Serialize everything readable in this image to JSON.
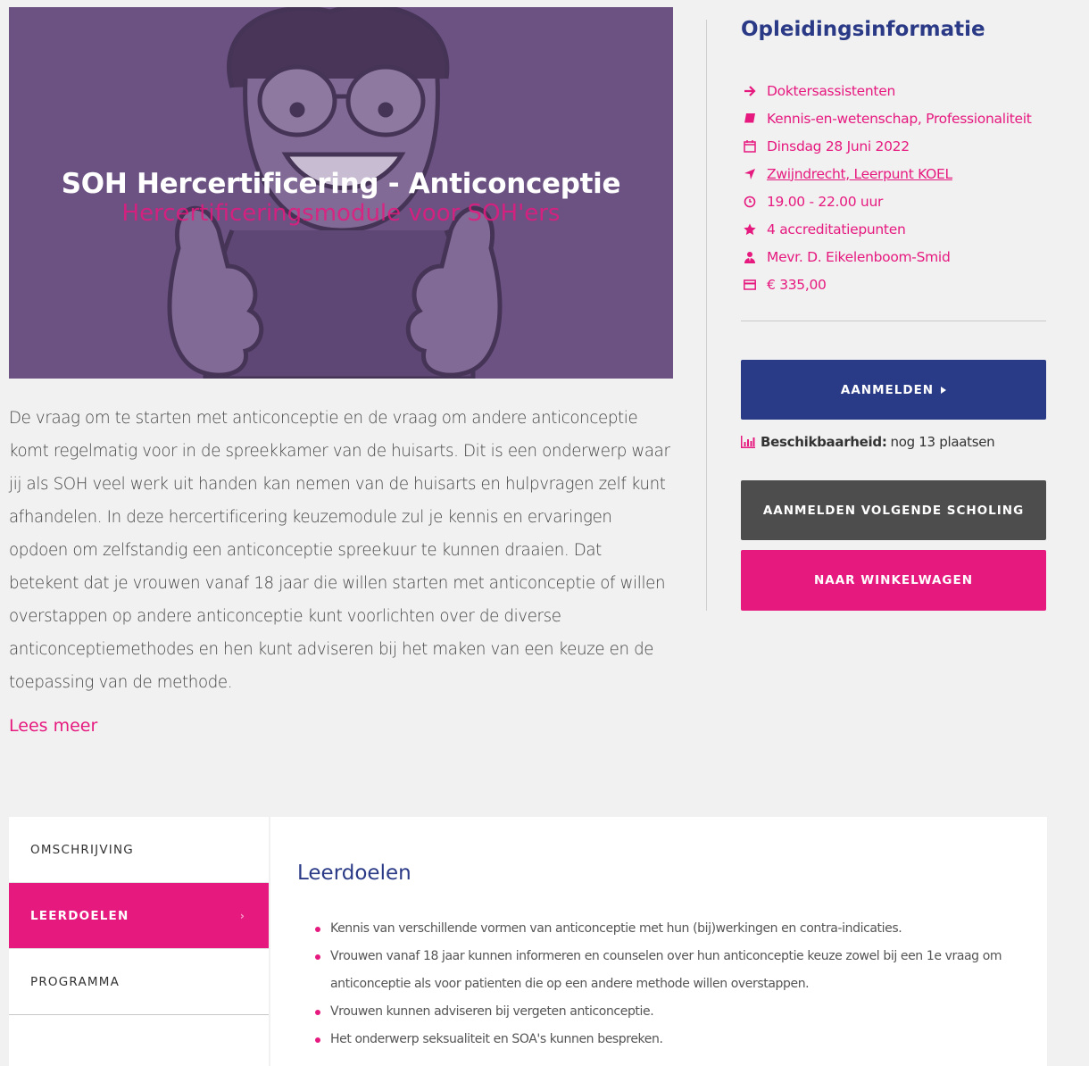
{
  "hero": {
    "title": "SOH Hercertificering - Anticonceptie",
    "subtitle": "Hercertificeringsmodule voor SOH'ers"
  },
  "description": "De vraag om te starten met anticonceptie en de vraag om andere anticonceptie komt regelmatig voor in de spreekkamer van de huisarts. Dit is een onderwerp waar jij als SOH veel werk uit handen kan nemen van de huisarts en hulpvragen zelf kunt afhandelen. In deze hercertificering keuzemodule zul je kennis en ervaringen opdoen om zelfstandig een anticonceptie spreekuur te kunnen draaien. Dat betekent dat je vrouwen vanaf 18 jaar die willen starten met anticonceptie of willen overstappen op andere anticonceptie kunt voorlichten over de diverse anticonceptiemethodes en hen kunt adviseren bij het maken van een keuze en de toepassing van de methode.",
  "lees_meer": "Lees meer",
  "sidebar": {
    "title": "Opleidingsinformatie",
    "items": [
      {
        "icon": "arrow-right-icon",
        "text": "Doktersassistenten"
      },
      {
        "icon": "book-icon",
        "text": "Kennis-en-wetenschap, Professionaliteit"
      },
      {
        "icon": "calendar-icon",
        "text": "Dinsdag 28 Juni 2022"
      },
      {
        "icon": "location-arrow-icon",
        "text": "Zwijndrecht, Leerpunt KOEL"
      },
      {
        "icon": "clock-icon",
        "text": "19.00 - 22.00 uur"
      },
      {
        "icon": "star-icon",
        "text": "4 accreditatiepunten"
      },
      {
        "icon": "user-tie-icon",
        "text": "Mevr. D. Eikelenboom-Smid"
      },
      {
        "icon": "credit-card-icon",
        "text": "€ 335,00"
      }
    ],
    "aanmelden": "AANMELDEN",
    "availability_label": "Beschikbaarheid:",
    "availability_value": "nog 13 plaatsen",
    "aanmelden_volgende": "AANMELDEN VOLGENDE SCHOLING",
    "winkelwagen": "NAAR WINKELWAGEN"
  },
  "tabs": [
    {
      "label": "OMSCHRIJVING",
      "active": false
    },
    {
      "label": "LEERDOELEN",
      "active": true
    },
    {
      "label": "PROGRAMMA",
      "active": false
    }
  ],
  "panel": {
    "title": "Leerdoelen",
    "items": [
      "Kennis van verschillende vormen van anticonceptie met hun (bij)werkingen en contra-indicaties.",
      "Vrouwen vanaf 18 jaar kunnen informeren en counselen over hun anticonceptie keuze zowel bij een 1e vraag om anticonceptie als voor patienten die op een andere methode willen overstappen.",
      "Vrouwen kunnen adviseren bij vergeten anticonceptie.",
      "Het onderwerp seksualiteit en SOA's kunnen bespreken."
    ]
  },
  "colors": {
    "accent": "#e6197f",
    "primary": "#293a87",
    "dark_button": "#4d4d4d",
    "hero_overlay": "#6b5282"
  }
}
